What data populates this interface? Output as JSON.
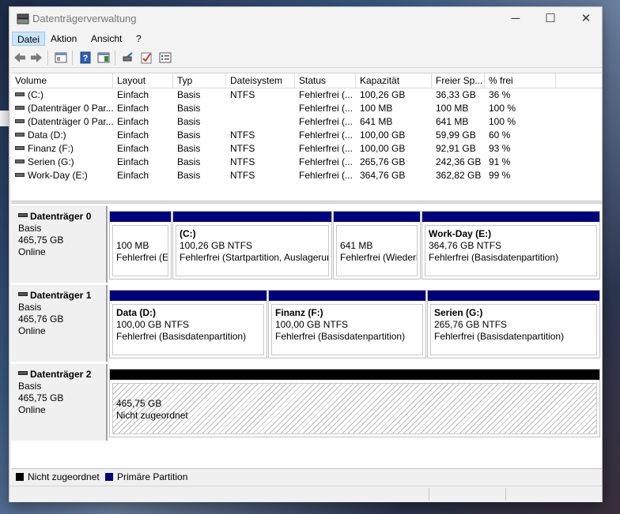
{
  "window": {
    "title": "Datenträgerverwaltung",
    "minimize_label": "─",
    "maximize_label": "☐",
    "close_label": "✕"
  },
  "menu": [
    "Datei",
    "Aktion",
    "Ansicht",
    "?"
  ],
  "toolbar_icons": [
    "back-arrow-icon",
    "forward-arrow-icon",
    "console-tree-icon",
    "help-icon",
    "action-pane-icon",
    "connect-icon",
    "check-icon",
    "properties-icon"
  ],
  "volume_table": {
    "headers": [
      "Volume",
      "Layout",
      "Typ",
      "Dateisystem",
      "Status",
      "Kapazität",
      "Freier Sp...",
      "% frei"
    ],
    "rows": [
      [
        "(C:)",
        "Einfach",
        "Basis",
        "NTFS",
        "Fehlerfrei (...",
        "100,26 GB",
        "36,33 GB",
        "36 %"
      ],
      [
        "(Datenträger 0 Par...",
        "Einfach",
        "Basis",
        "",
        "Fehlerfrei (...",
        "100 MB",
        "100 MB",
        "100 %"
      ],
      [
        "(Datenträger 0 Par...",
        "Einfach",
        "Basis",
        "",
        "Fehlerfrei (...",
        "641 MB",
        "641 MB",
        "100 %"
      ],
      [
        "Data (D:)",
        "Einfach",
        "Basis",
        "NTFS",
        "Fehlerfrei (...",
        "100,00 GB",
        "59,99 GB",
        "60 %"
      ],
      [
        "Finanz (F:)",
        "Einfach",
        "Basis",
        "NTFS",
        "Fehlerfrei (...",
        "100,00 GB",
        "92,91 GB",
        "93 %"
      ],
      [
        "Serien (G:)",
        "Einfach",
        "Basis",
        "NTFS",
        "Fehlerfrei (...",
        "265,76 GB",
        "242,36 GB",
        "91 %"
      ],
      [
        "Work-Day (E:)",
        "Einfach",
        "Basis",
        "NTFS",
        "Fehlerfrei (...",
        "364,76 GB",
        "362,82 GB",
        "99 %"
      ]
    ]
  },
  "disks": [
    {
      "name": "Datenträger 0",
      "type": "Basis",
      "size": "465,75 GB",
      "state": "Online",
      "partitions": [
        {
          "title": "",
          "size": "100 MB",
          "status": "Fehlerfrei (EI"
        },
        {
          "title": "(C:)",
          "size": "100,26 GB NTFS",
          "status": "Fehlerfrei (Startpartition, Auslagerun"
        },
        {
          "title": "",
          "size": "641 MB",
          "status": "Fehlerfrei (Wiederh"
        },
        {
          "title": "Work-Day  (E:)",
          "size": "364,76 GB NTFS",
          "status": "Fehlerfrei (Basisdatenpartition)"
        }
      ]
    },
    {
      "name": "Datenträger 1",
      "type": "Basis",
      "size": "465,76 GB",
      "state": "Online",
      "partitions": [
        {
          "title": "Data  (D:)",
          "size": "100,00 GB NTFS",
          "status": "Fehlerfrei (Basisdatenpartition)"
        },
        {
          "title": "Finanz  (F:)",
          "size": "100,00 GB NTFS",
          "status": "Fehlerfrei (Basisdatenpartition)"
        },
        {
          "title": "Serien  (G:)",
          "size": "265,76 GB NTFS",
          "status": "Fehlerfrei (Basisdatenpartition)"
        }
      ]
    },
    {
      "name": "Datenträger 2",
      "type": "Basis",
      "size": "465,75 GB",
      "state": "Online",
      "partitions": [
        {
          "title": "",
          "size": "465,75 GB",
          "status": "Nicht zugeordnet"
        }
      ]
    }
  ],
  "legend": {
    "unallocated": "Nicht zugeordnet",
    "primary": "Primäre Partition",
    "unallocated_color": "#000000",
    "primary_color": "#00007b"
  }
}
